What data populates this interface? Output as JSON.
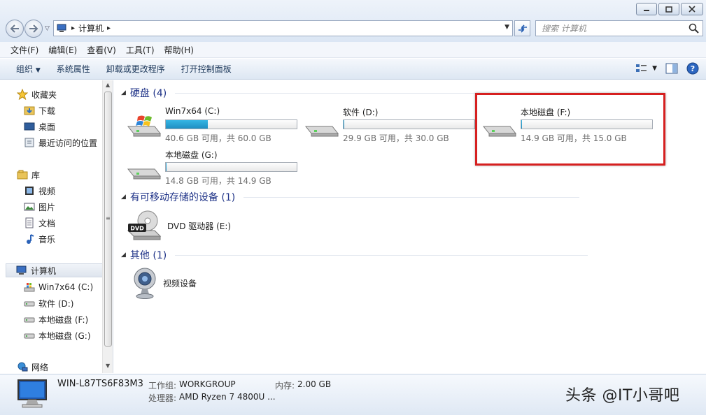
{
  "window": {
    "minimize_icon": "minimize-icon",
    "maximize_icon": "maximize-icon",
    "close_icon": "close-icon"
  },
  "address": {
    "root_arrow": "▸",
    "path_item": "计算机",
    "path_arrow": "▸"
  },
  "search": {
    "placeholder": "搜索 计算机"
  },
  "menu": [
    "文件(F)",
    "编辑(E)",
    "查看(V)",
    "工具(T)",
    "帮助(H)"
  ],
  "toolbar": {
    "organize": "组织",
    "system_props": "系统属性",
    "uninstall": "卸载或更改程序",
    "control_panel": "打开控制面板"
  },
  "nav": {
    "favorites": "收藏夹",
    "downloads": "下载",
    "desktop": "桌面",
    "recent": "最近访问的位置",
    "libraries": "库",
    "videos": "视频",
    "pictures": "图片",
    "documents": "文档",
    "music": "音乐",
    "computer": "计算机",
    "drive_c": "Win7x64 (C:)",
    "drive_d": "软件 (D:)",
    "drive_f": "本地磁盘 (F:)",
    "drive_g": "本地磁盘 (G:)",
    "network": "网络"
  },
  "groups": {
    "hdd": "硬盘 (4)",
    "removable": "有可移动存储的设备 (1)",
    "other": "其他 (1)"
  },
  "drives": [
    {
      "name": "Win7x64 (C:)",
      "free": "40.6 GB 可用，共 60.0 GB",
      "used_fraction": 0.32
    },
    {
      "name": "软件 (D:)",
      "free": "29.9 GB 可用，共 30.0 GB",
      "used_fraction": 0.003
    },
    {
      "name": "本地磁盘 (F:)",
      "free": "14.9 GB 可用，共 15.0 GB",
      "used_fraction": 0.007
    },
    {
      "name": "本地磁盘 (G:)",
      "free": "14.8 GB 可用，共 14.9 GB",
      "used_fraction": 0.007
    }
  ],
  "dvd": {
    "name": "DVD 驱动器 (E:)",
    "badge": "DVD"
  },
  "video_device": {
    "name": "视频设备"
  },
  "details": {
    "pc_name": "WIN-L87TS6F83M3",
    "workgroup_label": "工作组:",
    "workgroup": "WORKGROUP",
    "memory_label": "内存:",
    "memory": "2.00 GB",
    "cpu_label": "处理器:",
    "cpu": "AMD Ryzen 7 4800U ..."
  },
  "watermark": "头条 @IT小哥吧",
  "colors": {
    "accent_blue": "#1e3287",
    "highlight_red": "#d62020",
    "bar_fill": "#26a0d6"
  }
}
